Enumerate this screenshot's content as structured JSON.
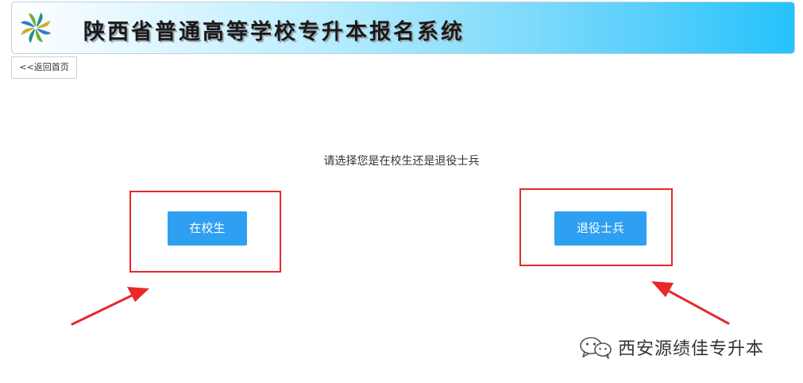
{
  "header": {
    "title": "陕西省普通高等学校专升本报名系统",
    "logo_icon": "pinwheel-logo-icon"
  },
  "nav": {
    "back_label": "<<返回首页"
  },
  "main": {
    "prompt": "请选择您是在校生还是退役士兵",
    "options": [
      {
        "label": "在校生"
      },
      {
        "label": "退役士兵"
      }
    ]
  },
  "watermark": {
    "text": "西安源绩佳专升本",
    "icon": "wechat-icon"
  },
  "colors": {
    "button": "#2f9ff2",
    "highlight_box": "#e8282a",
    "header_gradient_end": "#26c2fb"
  }
}
